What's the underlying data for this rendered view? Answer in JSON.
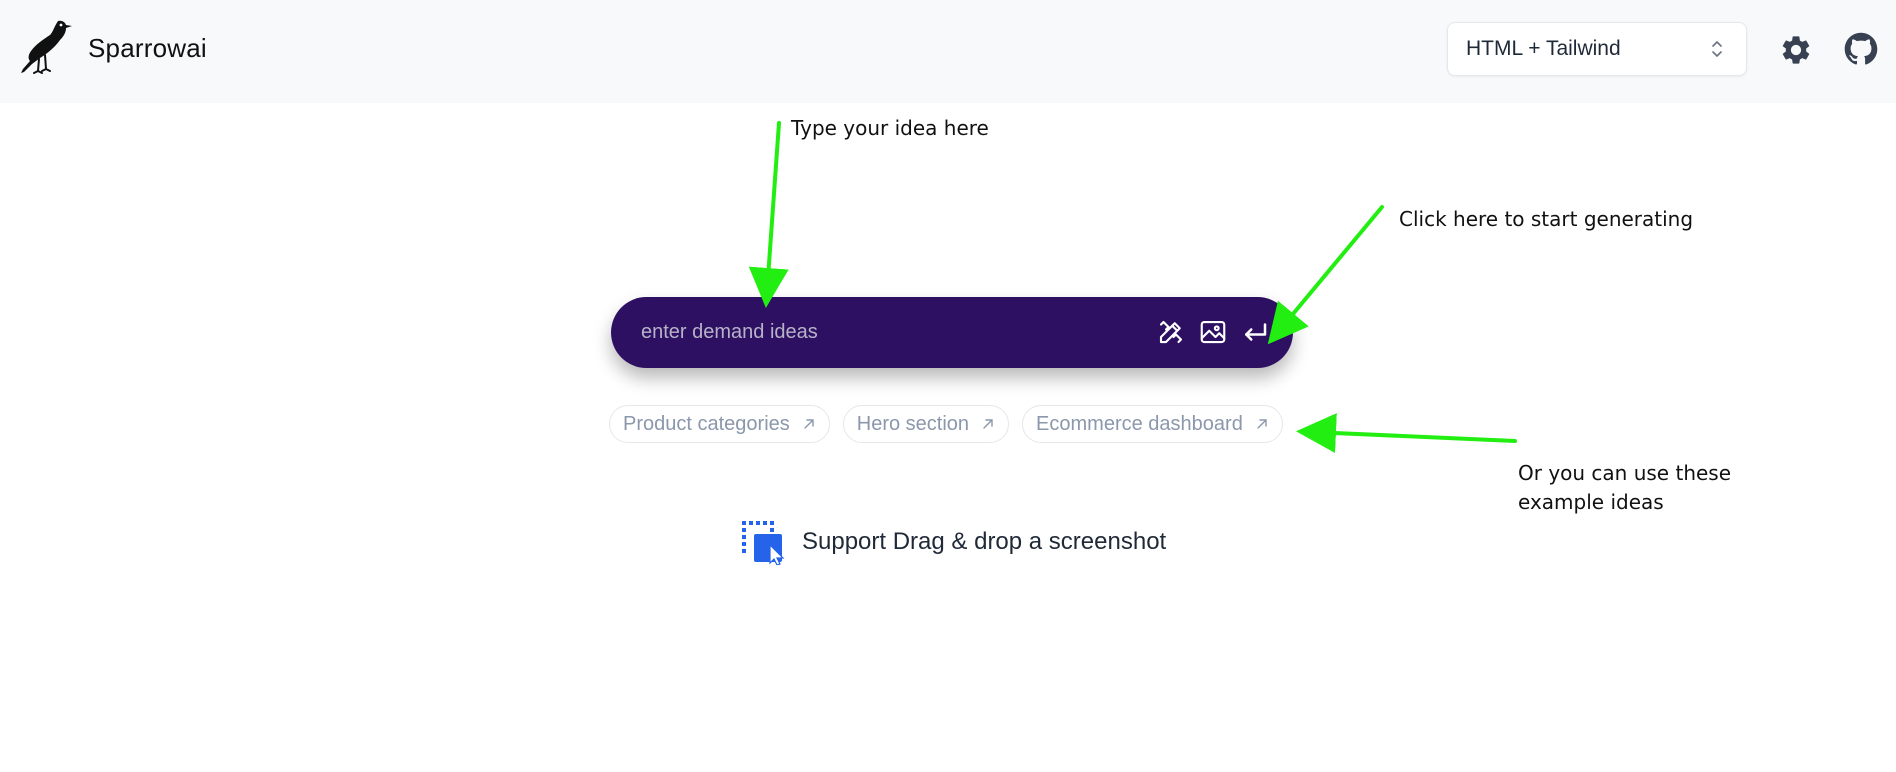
{
  "header": {
    "brand_name": "Sparrowai",
    "logo_icon": "sparrow-bird-logo",
    "framework_select": {
      "value": "HTML + Tailwind",
      "icon": "chevron-up-down-icon"
    },
    "settings_icon": "gear-icon",
    "github_icon": "github-icon"
  },
  "prompt": {
    "placeholder": "enter demand ideas",
    "value": "",
    "icons": [
      "design-tools-icon",
      "image-icon",
      "enter-icon"
    ],
    "background": "#2e1063"
  },
  "examples": [
    {
      "label": "Product categories",
      "icon": "arrow-up-right-icon"
    },
    {
      "label": "Hero section",
      "icon": "arrow-up-right-icon"
    },
    {
      "label": "Ecommerce dashboard",
      "icon": "arrow-up-right-icon"
    }
  ],
  "drag_drop": {
    "label": "Support Drag & drop a screenshot",
    "icon": "drag-drop-icon",
    "accent": "#2563eb"
  },
  "annotations": {
    "type_idea": "Type your idea here",
    "click_generate": "Click here to start generating",
    "use_examples": "Or you can use these example ideas",
    "arrow_color": "#22ee11"
  }
}
